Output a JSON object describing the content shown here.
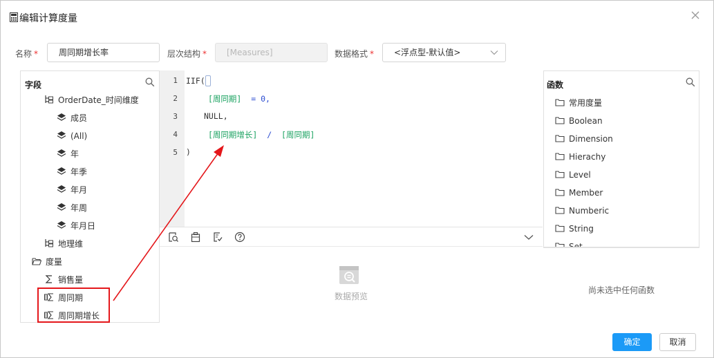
{
  "dialog": {
    "title": "编辑计算度量",
    "title_icon": "calculator-icon",
    "close_icon": "close-icon"
  },
  "form": {
    "name_label": "名称",
    "name_value": "周同期增长率",
    "hierarchy_label": "层次结构",
    "hierarchy_value": "[Measures]",
    "format_label": "数据格式",
    "format_value": "<浮点型-默认值>",
    "required_mark": "*"
  },
  "fields_panel": {
    "title": "字段",
    "items": [
      {
        "label": "OrderDate_时间维度",
        "icon": "hierarchy-icon"
      },
      {
        "label": "成员",
        "icon": "layers-icon"
      },
      {
        "label": "(All)",
        "icon": "layers-icon"
      },
      {
        "label": "年",
        "icon": "layers-icon"
      },
      {
        "label": "年季",
        "icon": "layers-icon"
      },
      {
        "label": "年月",
        "icon": "layers-icon"
      },
      {
        "label": "年周",
        "icon": "layers-icon"
      },
      {
        "label": "年月日",
        "icon": "layers-icon"
      },
      {
        "label": "地理维",
        "icon": "hierarchy-icon"
      },
      {
        "label": "度量",
        "icon": "folder-open-icon"
      },
      {
        "label": "销售量",
        "icon": "sigma-icon"
      },
      {
        "label": "周同期",
        "icon": "calc-measure-icon"
      },
      {
        "label": "周同期增长",
        "icon": "calc-measure-icon"
      }
    ]
  },
  "editor": {
    "line_numbers": [
      "1",
      "2",
      "3",
      "4",
      "5"
    ],
    "line1": "IIF(",
    "line2_field": "[周同期]",
    "line2_op": "= 0,",
    "line3": "NULL,",
    "line4_field_a": "[周同期增长]",
    "line4_op": "/",
    "line4_field_b": "[周同期]",
    "line5": ")"
  },
  "toolbar": {
    "icons": [
      "format-icon",
      "clipboard-icon",
      "validate-icon",
      "help-icon",
      "chevron-down-icon"
    ]
  },
  "preview": {
    "icon": "data-preview-icon",
    "label": "数据预览"
  },
  "functions_panel": {
    "title": "函数",
    "items": [
      "常用度量",
      "Boolean",
      "Dimension",
      "Hierachy",
      "Level",
      "Member",
      "Numberic",
      "String",
      "Set"
    ],
    "empty_text": "尚未选中任何函数"
  },
  "buttons": {
    "ok": "确定",
    "cancel": "取消"
  },
  "colors": {
    "primary": "#1b9af7",
    "highlight": "#e4161a",
    "field_token": "#1aa260",
    "operator_token": "#2a4bd0"
  }
}
